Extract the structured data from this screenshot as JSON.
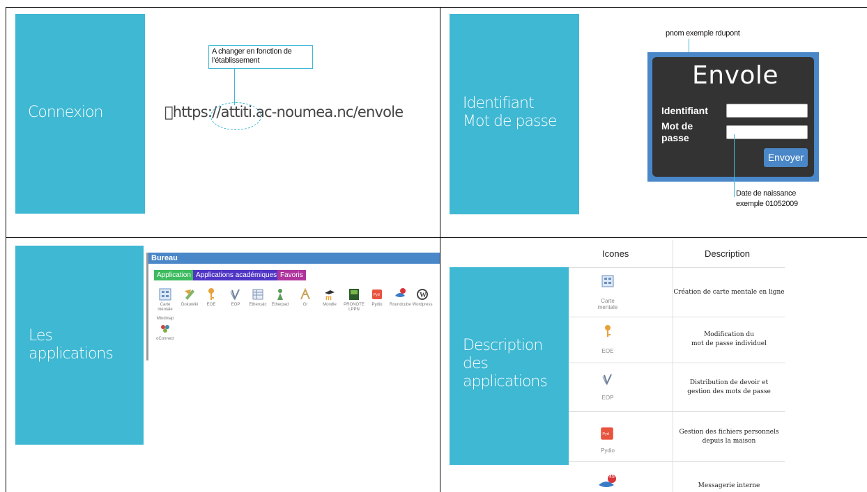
{
  "q1": {
    "slide_title": "Connexion",
    "callout": "A changer en fonction de\nl’établissement",
    "url": "https://attiti.ac-noumea.nc/envole",
    "colors": {
      "panel": "#3fb8d3"
    }
  },
  "q2": {
    "slide_title": "Identifiant\nMot de passe",
    "note_top": "pnom  exemple rdupont",
    "note_bottom": "Date de naissance\nexemple 01052009",
    "login": {
      "title": "Envole",
      "identifiant_label": "Identifiant",
      "password_label": "Mot de\npasse",
      "identifiant_value": "",
      "password_value": "",
      "submit": "Envoyer"
    }
  },
  "q3": {
    "slide_title": "Les\napplications",
    "bureau": {
      "title": "Bureau",
      "tabs": [
        {
          "label": "Application",
          "color": "#3dbb5f"
        },
        {
          "label": "Applications académiques",
          "color": "#4f35c5"
        },
        {
          "label": "Favoris",
          "color": "#b0349d"
        }
      ],
      "apps": [
        {
          "label": "Carte\nmentale",
          "icon": "mindmap-icon"
        },
        {
          "label": "Dokuwiki",
          "icon": "dokuwiki-icon"
        },
        {
          "label": "EOE",
          "icon": "key-icon"
        },
        {
          "label": "EOP",
          "icon": "eop-icon"
        },
        {
          "label": "Ethercalc",
          "icon": "spreadsheet-icon"
        },
        {
          "label": "Etherpad",
          "icon": "etherpad-icon"
        },
        {
          "label": "Gr",
          "icon": "gr-icon"
        },
        {
          "label": "Moodle",
          "icon": "moodle-icon"
        },
        {
          "label": "PRONOTE\nLPPN",
          "icon": "pronote-icon"
        },
        {
          "label": "Pydio",
          "icon": "pydio-icon"
        },
        {
          "label": "Roundcube",
          "icon": "roundcube-icon"
        },
        {
          "label": "Wordpress",
          "icon": "wordpress-icon"
        }
      ],
      "row2_overlap_label": "Mindmap",
      "row2_app": {
        "label": "oConnect",
        "icon": "oconnect-icon"
      }
    }
  },
  "q4": {
    "slide_title": "Description\ndes\napplications",
    "headers": {
      "icons": "Icones",
      "description": "Description"
    },
    "rows": [
      {
        "icon": "mindmap-icon",
        "label": "Carte\nmentale",
        "description": "Création de carte mentale en ligne"
      },
      {
        "icon": "key-icon",
        "label": "EOE",
        "description": "Modification du\nmot de passe individuel"
      },
      {
        "icon": "eop-icon",
        "label": "EOP",
        "description": "Distribution de devoir et\ngestion des mots de passe"
      },
      {
        "icon": "pydio-icon",
        "label": "Pydio",
        "description": "Gestion des fichiers personnels\ndepuis la maison"
      },
      {
        "icon": "roundcube-icon",
        "label": "",
        "badge": "45",
        "description": "Messagerie interne"
      }
    ]
  }
}
